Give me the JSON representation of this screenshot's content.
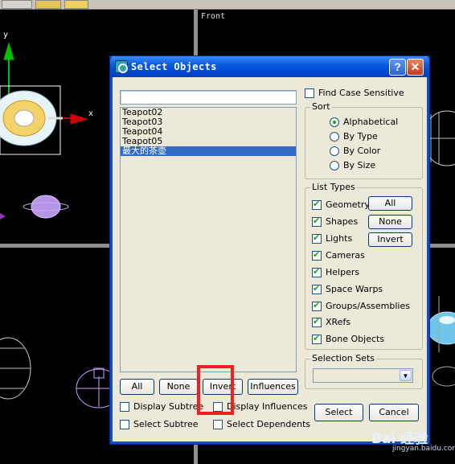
{
  "viewport": {
    "front_label": "Front",
    "axis_y": "y",
    "axis_x": "x"
  },
  "dialog": {
    "title": "Select Objects",
    "help_glyph": "?",
    "close_glyph": "✕",
    "search": {
      "value": "",
      "placeholder": ""
    },
    "objects": [
      "Teapot02",
      "Teapot03",
      "Teapot04",
      "Teapot05",
      "最大的茶壶"
    ],
    "selected_object": "最大的茶壶",
    "find_case_sensitive": {
      "label": "Find Case Sensitive",
      "checked": false
    },
    "sort": {
      "title": "Sort",
      "options": [
        "Alphabetical",
        "By Type",
        "By Color",
        "By Size"
      ],
      "selected": "Alphabetical"
    },
    "list_types": {
      "title": "List Types",
      "items": [
        {
          "label": "Geometry",
          "checked": true
        },
        {
          "label": "Shapes",
          "checked": true
        },
        {
          "label": "Lights",
          "checked": true
        },
        {
          "label": "Cameras",
          "checked": true
        },
        {
          "label": "Helpers",
          "checked": true
        },
        {
          "label": "Space Warps",
          "checked": true
        },
        {
          "label": "Groups/Assemblies",
          "checked": true
        },
        {
          "label": "XRefs",
          "checked": true
        },
        {
          "label": "Bone Objects",
          "checked": true
        }
      ],
      "all_label": "All",
      "none_label": "None",
      "invert_label": "Invert"
    },
    "selection_sets": {
      "title": "Selection Sets",
      "value": ""
    },
    "bottom_buttons": {
      "all": "All",
      "none": "None",
      "invert": "Invert",
      "influences": "Influences"
    },
    "display_subtree": {
      "label": "Display Subtree",
      "checked": false
    },
    "display_influences": {
      "label": "Display Influences",
      "checked": false
    },
    "select_subtree": {
      "label": "Select Subtree",
      "checked": false
    },
    "select_dependents": {
      "label": "Select Dependents",
      "checked": false
    },
    "select_label": "Select",
    "cancel_label": "Cancel"
  },
  "watermark": {
    "logo": "Bai 经验",
    "url": "jingyan.baidu.com"
  },
  "colors": {
    "title_bar": "#0a5be0",
    "selection": "#316ac5",
    "highlight": "#ee2020",
    "check": "#21a121"
  }
}
